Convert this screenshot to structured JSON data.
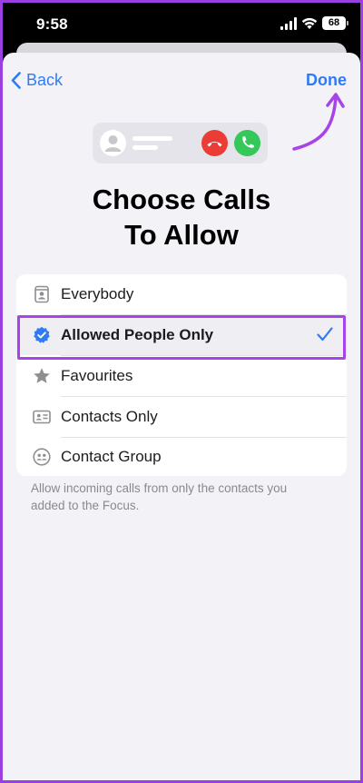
{
  "status_bar": {
    "time": "9:58",
    "battery": "68"
  },
  "nav": {
    "back_label": "Back",
    "done_label": "Done"
  },
  "title": {
    "line1": "Choose Calls",
    "line2": "To Allow"
  },
  "options": [
    {
      "label": "Everybody",
      "icon": "person-frame-icon",
      "selected": false
    },
    {
      "label": "Allowed People Only",
      "icon": "verified-badge-icon",
      "selected": true
    },
    {
      "label": "Favourites",
      "icon": "star-icon",
      "selected": false
    },
    {
      "label": "Contacts Only",
      "icon": "contact-card-icon",
      "selected": false
    },
    {
      "label": "Contact Group",
      "icon": "group-icon",
      "selected": false
    }
  ],
  "footnote": "Allow incoming calls from only the contacts you added to the Focus.",
  "colors": {
    "accent": "#2f7bf6",
    "highlight": "#a744e8",
    "decline": "#eb3c35",
    "accept": "#34c759"
  }
}
